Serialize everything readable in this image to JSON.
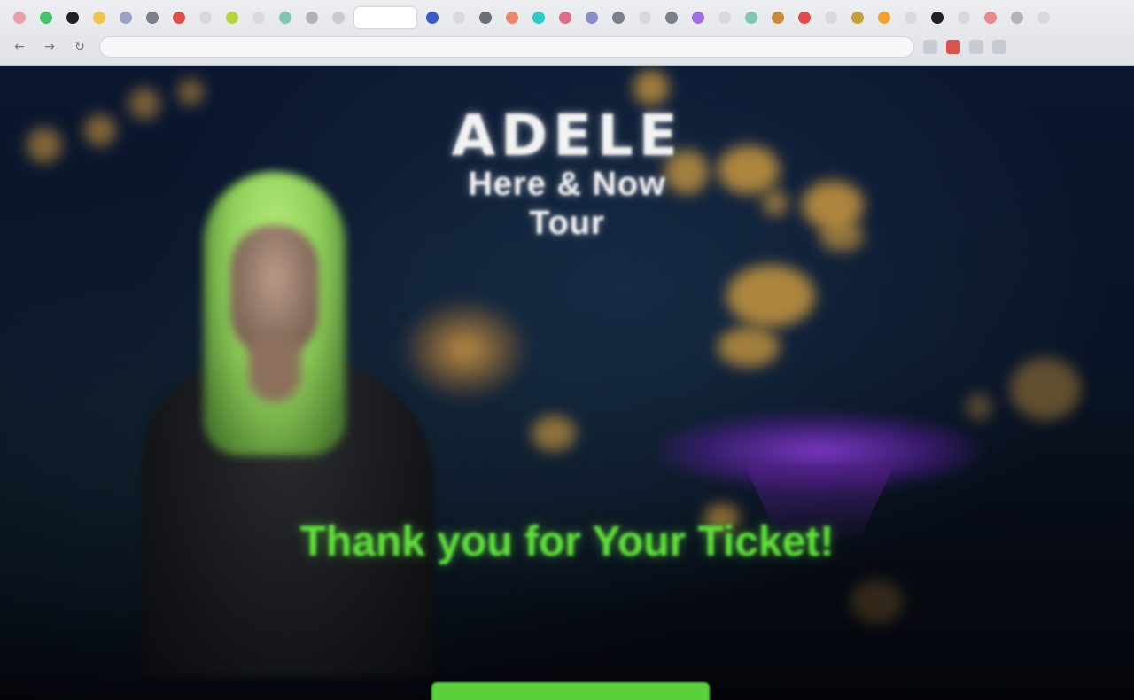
{
  "browser": {
    "tabs": [
      {
        "color": "#e9a0a6"
      },
      {
        "color": "#47c271"
      },
      {
        "color": "#222222"
      },
      {
        "color": "#f0c44a"
      },
      {
        "color": "#9aa0c8"
      },
      {
        "color": "#7a7f8a"
      },
      {
        "color": "#e0504a"
      },
      {
        "color": "#d7d9dc"
      },
      {
        "color": "#b6d43c"
      },
      {
        "color": "#d7d9dc"
      },
      {
        "color": "#7ec8b0"
      },
      {
        "color": "#b0b4ba"
      },
      {
        "color": "#c8ccd2"
      },
      {
        "color": "#ffffff",
        "active": true
      },
      {
        "color": "#3a5bc8"
      },
      {
        "color": "#d7d9dc"
      },
      {
        "color": "#6a6e76"
      },
      {
        "color": "#e88a6a"
      },
      {
        "color": "#2ec8c8"
      },
      {
        "color": "#e06a8a"
      },
      {
        "color": "#8a8ec8"
      },
      {
        "color": "#7a7f8a"
      },
      {
        "color": "#d7d9dc"
      },
      {
        "color": "#7a7f8a"
      },
      {
        "color": "#a070e0"
      },
      {
        "color": "#d7d9dc"
      },
      {
        "color": "#7ec8b0"
      },
      {
        "color": "#c88a3a"
      },
      {
        "color": "#e04a4a"
      },
      {
        "color": "#d7d9dc"
      },
      {
        "color": "#c8a03a"
      },
      {
        "color": "#f0a030"
      },
      {
        "color": "#d7d9dc"
      },
      {
        "color": "#222222"
      },
      {
        "color": "#d7d9dc"
      },
      {
        "color": "#e88a8a"
      },
      {
        "color": "#b0b4ba"
      },
      {
        "color": "#d7d9dc"
      }
    ],
    "address": ""
  },
  "hero": {
    "logo_small": "",
    "logo_main": "ADELE",
    "logo_sub": "Here & Now Tour",
    "headline": "Thank you for Your Ticket!",
    "description": "",
    "cta_label": ""
  },
  "colors": {
    "headline": "#5fe03c",
    "cta": "#5ad13b",
    "hair": "#8fd05a",
    "purple_glow": "#8c3cdc"
  }
}
